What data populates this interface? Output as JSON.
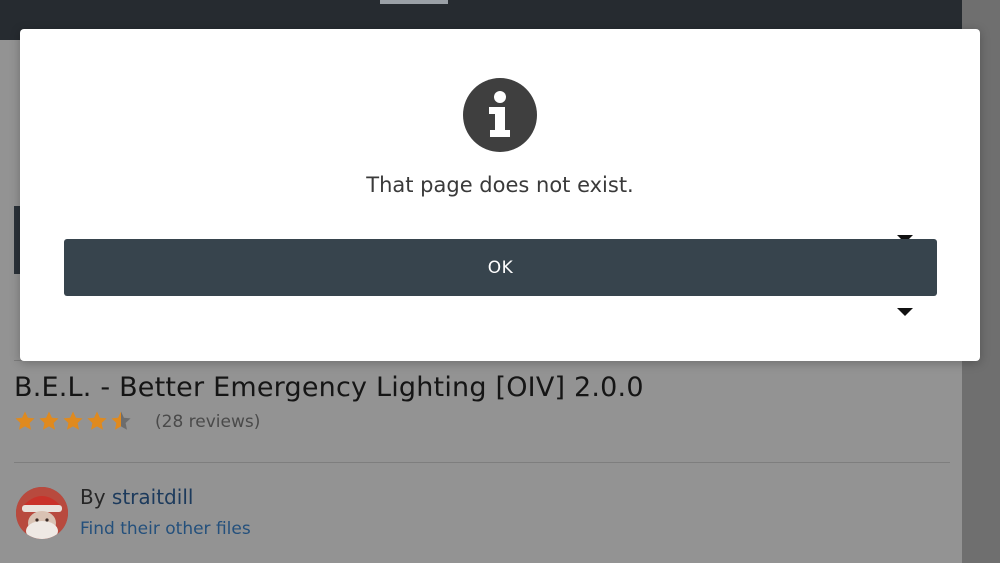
{
  "dialog": {
    "icon": "info-icon",
    "message": "That page does not exist.",
    "ok_label": "OK"
  },
  "file": {
    "title": "B.E.L. - Better Emergency Lighting [OIV] 2.0.0",
    "rating": 4.5,
    "rating_max": 5,
    "reviews": "(28 reviews)",
    "by_prefix": "By",
    "author": "straitdill",
    "other_files": "Find their other files"
  },
  "colors": {
    "button": "#37444d",
    "star": "#e08a1e",
    "link": "#24507c",
    "icon": "#3f3f3f"
  }
}
